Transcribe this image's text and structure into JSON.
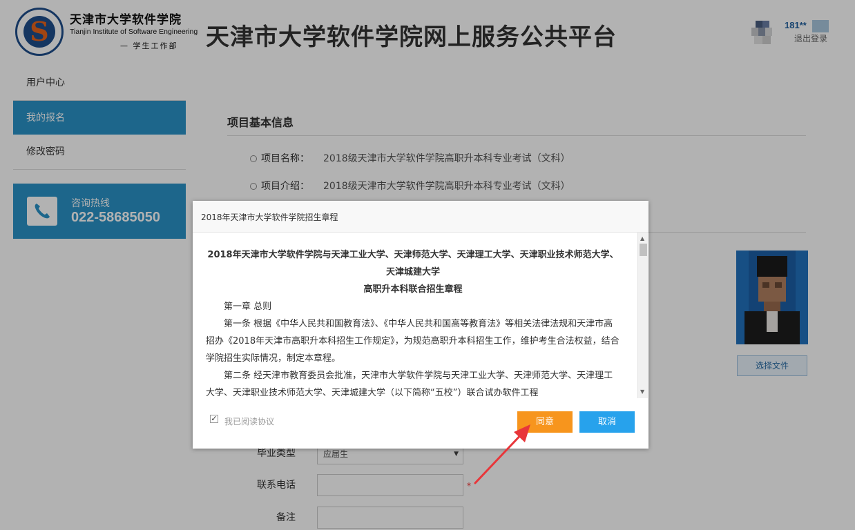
{
  "header": {
    "logo_cn": "天津市大学软件学院",
    "logo_en": "Tianjin Institute of Software Engineering",
    "logo_dept": "— 学生工作部",
    "logo_ring": "Tianjin Institute of Software Engineering",
    "title": "天津市大学软件学院网上服务公共平台",
    "user_name": "181**",
    "logout": "退出登录"
  },
  "sidebar": {
    "items": [
      {
        "label": "用户中心",
        "active": false
      },
      {
        "label": "我的报名",
        "active": true
      },
      {
        "label": "修改密码",
        "active": false
      }
    ],
    "hotline": {
      "label": "咨询热线",
      "number": "022-58685050"
    }
  },
  "main": {
    "section_title": "项目基本信息",
    "project_name_label": "项目名称：",
    "project_name": "2018级天津市大学软件学院高职升本科专业考试（文科）",
    "project_intro_label": "项目介绍：",
    "project_intro": "2018级天津市大学软件学院高职升本科专业考试（文科）",
    "choose_file": "选择文件",
    "form": {
      "graduate_type_label": "毕业类型",
      "graduate_type_value": "应届生",
      "phone_label": "联系电话",
      "required": "*",
      "remark_label": "备注"
    }
  },
  "modal": {
    "title": "2018年天津市大学软件学院招生章程",
    "heading_line1": "2018年天津市大学软件学院与天津工业大学、天津师范大学、天津理工大学、天津职业技术师范大学、天津城建大学",
    "heading_line2": "高职升本科联合招生章程",
    "chapter": "第一章 总则",
    "article1": "第一条 根据《中华人民共和国教育法》、《中华人民共和国高等教育法》等相关法律法规和天津市高招办《2018年天津市高职升本科招生工作规定》，为规范高职升本科招生工作，维护考生合法权益，结合学院招生实际情况，制定本章程。",
    "article2": "第二条 经天津市教育委员会批准，天津市大学软件学院与天津工业大学、天津师范大学、天津理工大学、天津职业技术师范大学、天津城建大学（以下简称“五校”）联合试办软件工程",
    "agree_label": "我已阅读协议",
    "agree_checked": true,
    "btn_agree": "同意",
    "btn_cancel": "取消"
  },
  "colors": {
    "accent_blue": "#2a93c8",
    "agree_orange": "#f7951d",
    "cancel_blue": "#27a2ec",
    "arrow_red": "#e8363a"
  }
}
